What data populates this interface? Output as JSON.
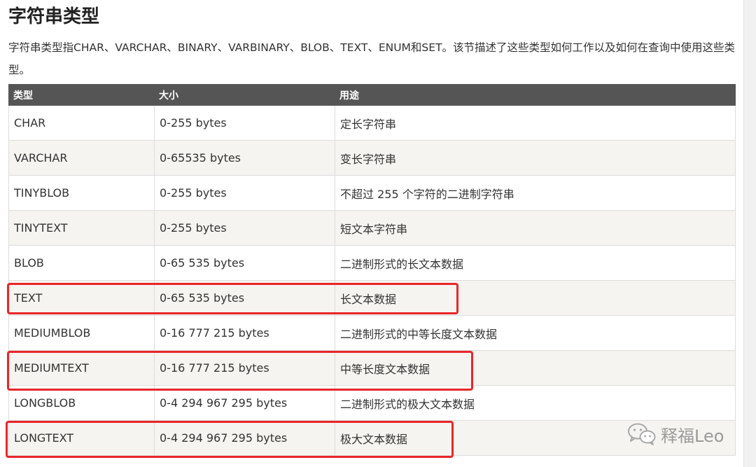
{
  "title": "字符串类型",
  "intro": "字符串类型指CHAR、VARCHAR、BINARY、VARBINARY、BLOB、TEXT、ENUM和SET。该节描述了这些类型如何工作以及如何在查询中使用这些类型。",
  "table": {
    "headers": [
      "类型",
      "大小",
      "用途"
    ],
    "rows": [
      {
        "type": "CHAR",
        "size": "0-255 bytes",
        "use": "定长字符串",
        "highlighted": false
      },
      {
        "type": "VARCHAR",
        "size": "0-65535 bytes",
        "use": "变长字符串",
        "highlighted": false
      },
      {
        "type": "TINYBLOB",
        "size": "0-255 bytes",
        "use": "不超过 255 个字符的二进制字符串",
        "highlighted": false
      },
      {
        "type": "TINYTEXT",
        "size": "0-255 bytes",
        "use": "短文本字符串",
        "highlighted": false
      },
      {
        "type": "BLOB",
        "size": "0-65 535 bytes",
        "use": "二进制形式的长文本数据",
        "highlighted": false
      },
      {
        "type": "TEXT",
        "size": "0-65 535 bytes",
        "use": "长文本数据",
        "highlighted": true
      },
      {
        "type": "MEDIUMBLOB",
        "size": "0-16 777 215 bytes",
        "use": "二进制形式的中等长度文本数据",
        "highlighted": false
      },
      {
        "type": "MEDIUMTEXT",
        "size": "0-16 777 215 bytes",
        "use": "中等长度文本数据",
        "highlighted": true
      },
      {
        "type": "LONGBLOB",
        "size": "0-4 294 967 295 bytes",
        "use": "二进制形式的极大文本数据",
        "highlighted": false
      },
      {
        "type": "LONGTEXT",
        "size": "0-4 294 967 295 bytes",
        "use": "极大文本数据",
        "highlighted": true
      }
    ]
  },
  "watermark": {
    "text": "释福Leo",
    "icon": "wechat-icon"
  },
  "colors": {
    "header_bg": "#555555",
    "highlight": "#e8262a",
    "row_alt": "#f6f4f0"
  }
}
